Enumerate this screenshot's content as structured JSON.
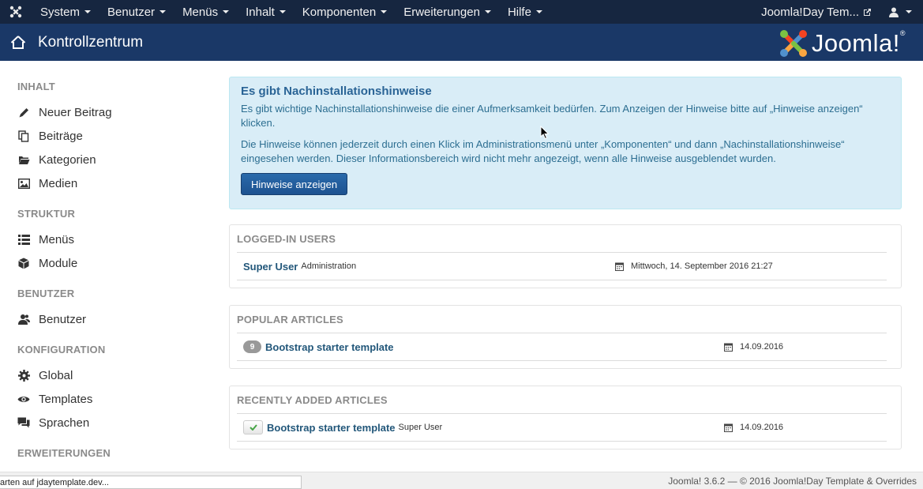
{
  "navbar": {
    "menus": [
      {
        "label": "System"
      },
      {
        "label": "Benutzer"
      },
      {
        "label": "Menüs"
      },
      {
        "label": "Inhalt"
      },
      {
        "label": "Komponenten"
      },
      {
        "label": "Erweiterungen"
      },
      {
        "label": "Hilfe"
      }
    ],
    "site_name": "Joomla!Day Tem...",
    "icons": {
      "logo": "joomla-icon",
      "external": "external-link-icon",
      "user": "user-icon"
    }
  },
  "subhead": {
    "title": "Kontrollzentrum",
    "brand": "Joomla!",
    "brand_reg": "®"
  },
  "sidebar": {
    "sections": [
      {
        "heading": "INHALT",
        "items": [
          {
            "label": "Neuer Beitrag",
            "icon": "pencil-icon"
          },
          {
            "label": "Beiträge",
            "icon": "copy-icon"
          },
          {
            "label": "Kategorien",
            "icon": "folder-icon"
          },
          {
            "label": "Medien",
            "icon": "image-icon"
          }
        ]
      },
      {
        "heading": "STRUKTUR",
        "items": [
          {
            "label": "Menüs",
            "icon": "list-icon"
          },
          {
            "label": "Module",
            "icon": "cube-icon"
          }
        ]
      },
      {
        "heading": "BENUTZER",
        "items": [
          {
            "label": "Benutzer",
            "icon": "users-icon"
          }
        ]
      },
      {
        "heading": "KONFIGURATION",
        "items": [
          {
            "label": "Global",
            "icon": "gear-icon"
          },
          {
            "label": "Templates",
            "icon": "eye-icon"
          },
          {
            "label": "Sprachen",
            "icon": "comments-icon"
          }
        ]
      },
      {
        "heading": "ERWEITERUNGEN",
        "items": []
      }
    ]
  },
  "alert": {
    "title": "Es gibt Nachinstallationshinweise",
    "text1": "Es gibt wichtige Nachinstallationshinweise die einer Aufmerksamkeit bedürfen. Zum Anzeigen der Hinweise bitte auf „Hinweise anzeigen“ klicken.",
    "text2": "Die Hinweise können jederzeit durch einen Klick im Administrationsmenü unter „Komponenten“ und dann „Nachinstallationshinweise“ eingesehen werden. Dieser Informationsbereich wird nicht mehr angezeigt, wenn alle Hinweise ausgeblendet wurden.",
    "button": "Hinweise anzeigen"
  },
  "logged_in": {
    "heading": "LOGGED-IN USERS",
    "rows": [
      {
        "name": "Super User",
        "meta": "Administration",
        "date": "Mittwoch, 14. September 2016 21:27"
      }
    ]
  },
  "popular": {
    "heading": "POPULAR ARTICLES",
    "rows": [
      {
        "hits": "9",
        "title": "Bootstrap starter template",
        "date": "14.09.2016"
      }
    ]
  },
  "recent": {
    "heading": "RECENTLY ADDED ARTICLES",
    "rows": [
      {
        "title": "Bootstrap starter template",
        "author": "Super User",
        "date": "14.09.2016"
      }
    ]
  },
  "footer": {
    "text": "Joomla! 3.6.2 — © 2016 Joomla!Day Template & Overrides"
  },
  "statusbar": {
    "text": "arten auf jdaytemplate.dev..."
  }
}
